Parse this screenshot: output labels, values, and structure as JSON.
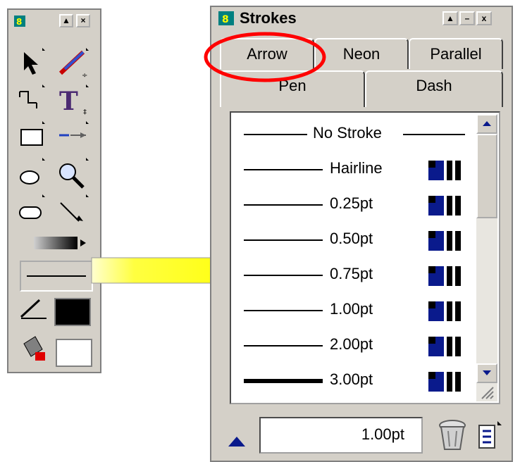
{
  "tools_palette": {
    "close_glyph": "×",
    "pin_glyph": "▲",
    "stroke_swatch_icon": "stroke-line-icon",
    "stroke_color": "#000000",
    "fill_color": "#ffffff"
  },
  "strokes_panel": {
    "title": "Strokes",
    "title_buttons": [
      "▲",
      "–",
      "x"
    ],
    "tabs": [
      {
        "label": "Arrow"
      },
      {
        "label": "Neon"
      },
      {
        "label": "Parallel"
      },
      {
        "label": "Pen"
      },
      {
        "label": "Dash"
      }
    ],
    "active_tab": "Pen",
    "stroke_list": [
      {
        "label": "No Stroke",
        "weight": 0
      },
      {
        "label": "Hairline",
        "weight": 1
      },
      {
        "label": "0.25pt",
        "weight": 1
      },
      {
        "label": "0.50pt",
        "weight": 1
      },
      {
        "label": "0.75pt",
        "weight": 1
      },
      {
        "label": "1.00pt",
        "weight": 1.5
      },
      {
        "label": "2.00pt",
        "weight": 2
      },
      {
        "label": "3.00pt",
        "weight": 5
      }
    ],
    "stroke_size_value": "1.00pt"
  },
  "colors": {
    "panel_bg": "#d4d0c8",
    "highlight": "#ff0000",
    "callout": "#ffff00",
    "accent": "#0a1a8c"
  }
}
